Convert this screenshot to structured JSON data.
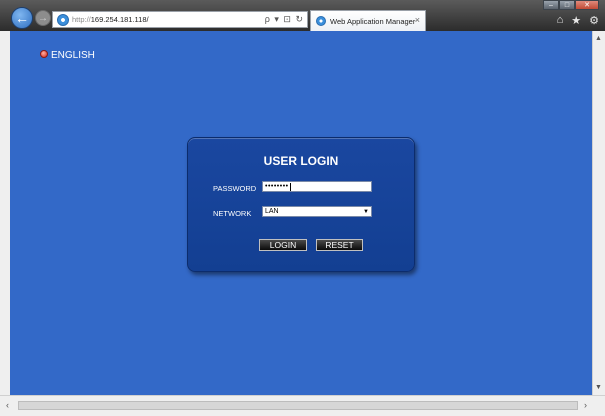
{
  "browser": {
    "url_scheme": "http://",
    "url_host": "169.254.181.118/",
    "address_tools": "ρ ▾ ⊡ ↻",
    "tab_title": "Web Application Manager",
    "tab_close": "×",
    "back_glyph": "←",
    "forward_glyph": "→",
    "toolbar_home": "⌂",
    "toolbar_star": "★",
    "toolbar_gear": "⚙",
    "window_min": "–",
    "window_max": "□",
    "window_close": "✕"
  },
  "page": {
    "language": "ENGLISH",
    "login": {
      "title": "USER LOGIN",
      "password_label": "PASSWORD",
      "password_value": "••••••••",
      "network_label": "NETWORK",
      "network_selected": "LAN",
      "login_button": "LOGIN",
      "reset_button": "RESET"
    }
  },
  "scrollbars": {
    "up": "▲",
    "down": "▼",
    "left": "‹",
    "right": "›"
  },
  "colors": {
    "page_background": "#3369c8",
    "login_box": "#1a47a0",
    "button_background": "#0a0a0a"
  }
}
